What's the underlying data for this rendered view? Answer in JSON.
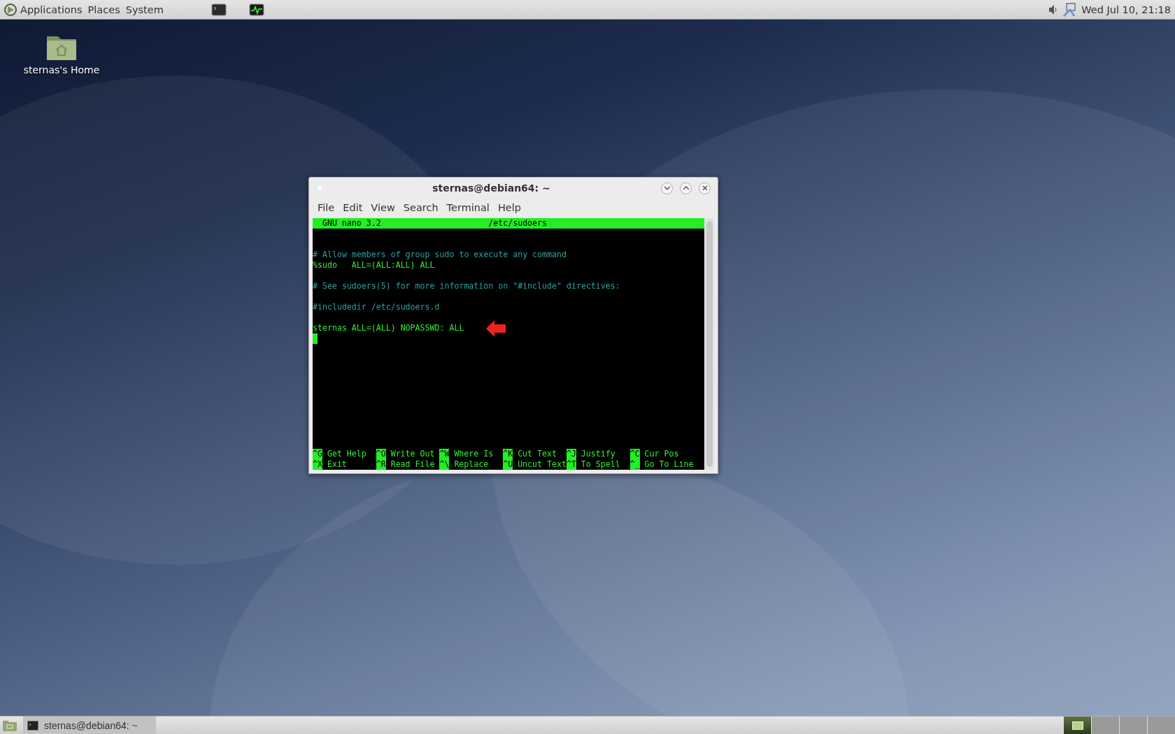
{
  "top_panel": {
    "menus": [
      "Applications",
      "Places",
      "System"
    ],
    "clock": "Wed Jul 10, 21:18"
  },
  "desktop_icons": [
    {
      "label": "sternas's Home"
    }
  ],
  "window": {
    "title": "sternas@debian64: ~",
    "menu": [
      "File",
      "Edit",
      "View",
      "Search",
      "Terminal",
      "Help"
    ],
    "nano": {
      "version": "GNU nano 3.2",
      "filename": "/etc/sudoers",
      "lines": [
        {
          "kind": "blank"
        },
        {
          "kind": "blank"
        },
        {
          "kind": "comment",
          "text": "# Allow members of group sudo to execute any command"
        },
        {
          "kind": "directive",
          "text": "%sudo   ALL=(ALL:ALL) ALL"
        },
        {
          "kind": "blank"
        },
        {
          "kind": "comment",
          "text": "# See sudoers(5) for more information on \"#include\" directives:"
        },
        {
          "kind": "blank"
        },
        {
          "kind": "comment",
          "text": "#includedir /etc/sudoers.d"
        },
        {
          "kind": "blank"
        },
        {
          "kind": "directive",
          "text": "sternas ALL=(ALL) NOPASSWD: ALL",
          "arrow": true
        },
        {
          "kind": "cursor"
        }
      ],
      "shortcuts": [
        [
          {
            "key": "^G",
            "label": "Get Help"
          },
          {
            "key": "^O",
            "label": "Write Out"
          },
          {
            "key": "^W",
            "label": "Where Is"
          },
          {
            "key": "^K",
            "label": "Cut Text"
          },
          {
            "key": "^J",
            "label": "Justify"
          },
          {
            "key": "^C",
            "label": "Cur Pos"
          }
        ],
        [
          {
            "key": "^X",
            "label": "Exit"
          },
          {
            "key": "^R",
            "label": "Read File"
          },
          {
            "key": "^\\",
            "label": "Replace"
          },
          {
            "key": "^U",
            "label": "Uncut Text"
          },
          {
            "key": "^T",
            "label": "To Spell"
          },
          {
            "key": "^_",
            "label": "Go To Line"
          }
        ]
      ]
    }
  },
  "taskbar": {
    "tasks": [
      {
        "label": "sternas@debian64: ~"
      }
    ],
    "workspaces": [
      {
        "selected": true
      },
      {
        "selected": false
      },
      {
        "selected": false
      },
      {
        "selected": false
      }
    ]
  }
}
